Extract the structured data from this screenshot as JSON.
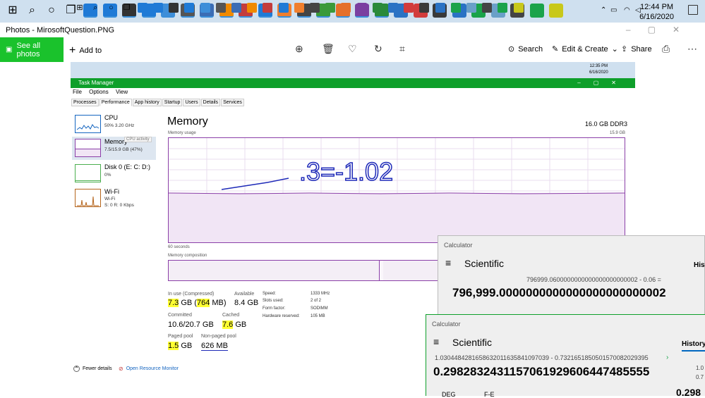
{
  "taskbar": {
    "time": "12:44 PM",
    "date": "6/16/2020",
    "icons": [
      {
        "name": "windows-start-icon",
        "color": "#222"
      },
      {
        "name": "search-icon",
        "color": "#222"
      },
      {
        "name": "cortana-icon",
        "color": "#222"
      },
      {
        "name": "task-view-icon",
        "color": "#222"
      },
      {
        "name": "edge-icon",
        "color": "#1f7ad6"
      },
      {
        "name": "edge-legacy-icon",
        "color": "#1f7ad6"
      },
      {
        "name": "store-icon",
        "color": "#333"
      },
      {
        "name": "mail-icon",
        "color": "#1f7ad6"
      },
      {
        "name": "app-window-icon",
        "color": "#3d8ed9"
      },
      {
        "name": "settings-icon",
        "color": "#555"
      },
      {
        "name": "photo-icon",
        "color": "#3b6db5"
      },
      {
        "name": "vlc-icon",
        "color": "#f08a00"
      },
      {
        "name": "red-circle-icon",
        "color": "#c43c3c"
      },
      {
        "name": "vscode-icon",
        "color": "#1f7ad6"
      },
      {
        "name": "orange-app-icon",
        "color": "#f07f2e"
      },
      {
        "name": "7zip-icon",
        "color": "#444"
      },
      {
        "name": "globe-icon",
        "color": "#3a9a3a"
      },
      {
        "name": "firefox-icon",
        "color": "#e5702a"
      },
      {
        "name": "purple-app-icon",
        "color": "#7a3fa0"
      },
      {
        "name": "green-app-icon",
        "color": "#2a8a3a"
      },
      {
        "name": "blue-app-icon",
        "color": "#2a72c4"
      },
      {
        "name": "snip-icon",
        "color": "#d23c3c"
      },
      {
        "name": "grid-app-icon",
        "color": "#3a3a3a"
      },
      {
        "name": "phone-icon",
        "color": "#2a72c4"
      },
      {
        "name": "green-diamond-icon",
        "color": "#1aa34a"
      },
      {
        "name": "picture-icon",
        "color": "#6aa0c8"
      },
      {
        "name": "calculator-icon",
        "color": "#444"
      },
      {
        "name": "spreadsheet-icon",
        "color": "#1aa34a"
      },
      {
        "name": "yellow-app-icon",
        "color": "#c8c81a"
      }
    ]
  },
  "photos": {
    "window_title": "Photos - MirosoftQuestion.PNG",
    "see_all": "See all photos",
    "add_to": "Add to",
    "search": "Search",
    "edit_create": "Edit & Create",
    "share": "Share"
  },
  "task_manager": {
    "title": "Task Manager",
    "inner_time": "12:35 PM",
    "inner_date": "6/16/2020",
    "menu": [
      "File",
      "Options",
      "View"
    ],
    "tabs": [
      "Processes",
      "Performance",
      "App history",
      "Startup",
      "Users",
      "Details",
      "Services"
    ],
    "active_tab": "Performance",
    "sidebar": [
      {
        "name": "CPU",
        "sub": "50% 3.20 GHz"
      },
      {
        "name": "Memory",
        "sub": "7.5/15.9 GB (47%)"
      },
      {
        "name": "Disk 0 (E: C: D:)",
        "sub": "0%"
      },
      {
        "name": "Wi-Fi",
        "sub": "Wi-Fi",
        "sub2": "S: 0 R: 0 Kbps"
      }
    ],
    "tooltip": "CPU activity",
    "memory": {
      "title": "Memory",
      "capacity": "16.0 GB DDR3",
      "usage_label": "Memory usage",
      "usage_max": "15.9 GB",
      "seconds": "60 seconds",
      "composition_label": "Memory composition",
      "in_use_label": "In use (Compressed)",
      "in_use_a": "7.3",
      "in_use_b": " GB (",
      "in_use_c": "764",
      "in_use_d": " MB)",
      "available_label": "Available",
      "available": "8.4 GB",
      "committed_label": "Committed",
      "committed": "10.6/20.7 GB",
      "cached_label": "Cached",
      "cached_a": "7.6",
      "cached_b": " GB",
      "paged_label": "Paged pool",
      "paged_a": "1.5",
      "paged_b": " GB",
      "nonpaged_label": "Non-paged pool",
      "nonpaged": "626 MB",
      "speed_label": "Speed:",
      "speed": "1333 MHz",
      "slots_label": "Slots used:",
      "slots": "2 of 2",
      "form_label": "Form factor:",
      "form": "SODIMM",
      "reserved_label": "Hardware reserved:",
      "reserved": "105 MB",
      "handwriting": ".3=-1.02"
    },
    "footer": {
      "fewer": "Fewer details",
      "monitor": "Open Resource Monitor"
    }
  },
  "calc1": {
    "title": "Calculator",
    "mode": "Scientific",
    "history": "His",
    "expression": "796999.0600000000000000000000002 - 0.06 =",
    "result": "796,999.0000000000000000000000002"
  },
  "calc2": {
    "title": "Calculator",
    "mode": "Scientific",
    "history": "History",
    "expression": "1.0304484281658632011635841097039 - 0.7321651850501570082029395",
    "result": "0.2982832431157061929606447485555",
    "deg": "DEG",
    "fe": "F-E",
    "side1": "1.0",
    "side2": "0.7",
    "side3": "0.298"
  }
}
